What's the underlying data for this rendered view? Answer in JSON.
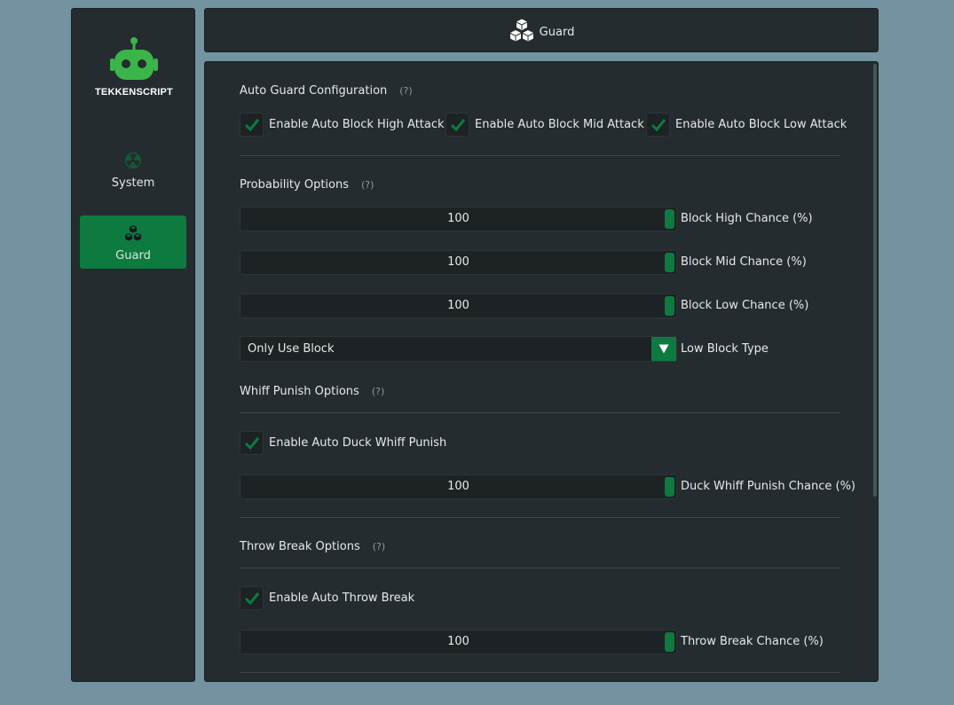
{
  "app": {
    "brand": "TEKKENSCRIPT"
  },
  "colors": {
    "accent": "#0d7a40",
    "brand_green": "#3bb54a",
    "panel": "#252c2f",
    "background": "#7393a1"
  },
  "sidebar": {
    "items": [
      {
        "label": "System",
        "icon": "radiation-icon",
        "active": false
      },
      {
        "label": "Guard",
        "icon": "cubes-icon",
        "active": true
      }
    ]
  },
  "header": {
    "title": "Guard",
    "icon": "cubes-icon"
  },
  "help_marker": "(?)",
  "sections": {
    "auto_guard": {
      "title": "Auto Guard Configuration",
      "checks": [
        {
          "label": "Enable Auto Block High Attack",
          "checked": true
        },
        {
          "label": "Enable Auto Block Mid Attack",
          "checked": true
        },
        {
          "label": "Enable Auto Block Low Attack",
          "checked": true
        }
      ]
    },
    "probability": {
      "title": "Probability Options",
      "sliders": [
        {
          "value": "100",
          "label": "Block High Chance (%)"
        },
        {
          "value": "100",
          "label": "Block Mid Chance (%)"
        },
        {
          "value": "100",
          "label": "Block Low Chance (%)"
        }
      ],
      "combo": {
        "value": "Only Use Block",
        "label": "Low Block Type"
      }
    },
    "whiff": {
      "title": "Whiff Punish Options",
      "check": {
        "label": "Enable Auto Duck Whiff Punish",
        "checked": true
      },
      "slider": {
        "value": "100",
        "label": "Duck Whiff Punish Chance (%)"
      }
    },
    "throw": {
      "title": "Throw Break Options",
      "check": {
        "label": "Enable Auto Throw Break",
        "checked": true
      },
      "slider": {
        "value": "100",
        "label": "Throw Break Chance (%)"
      }
    }
  }
}
